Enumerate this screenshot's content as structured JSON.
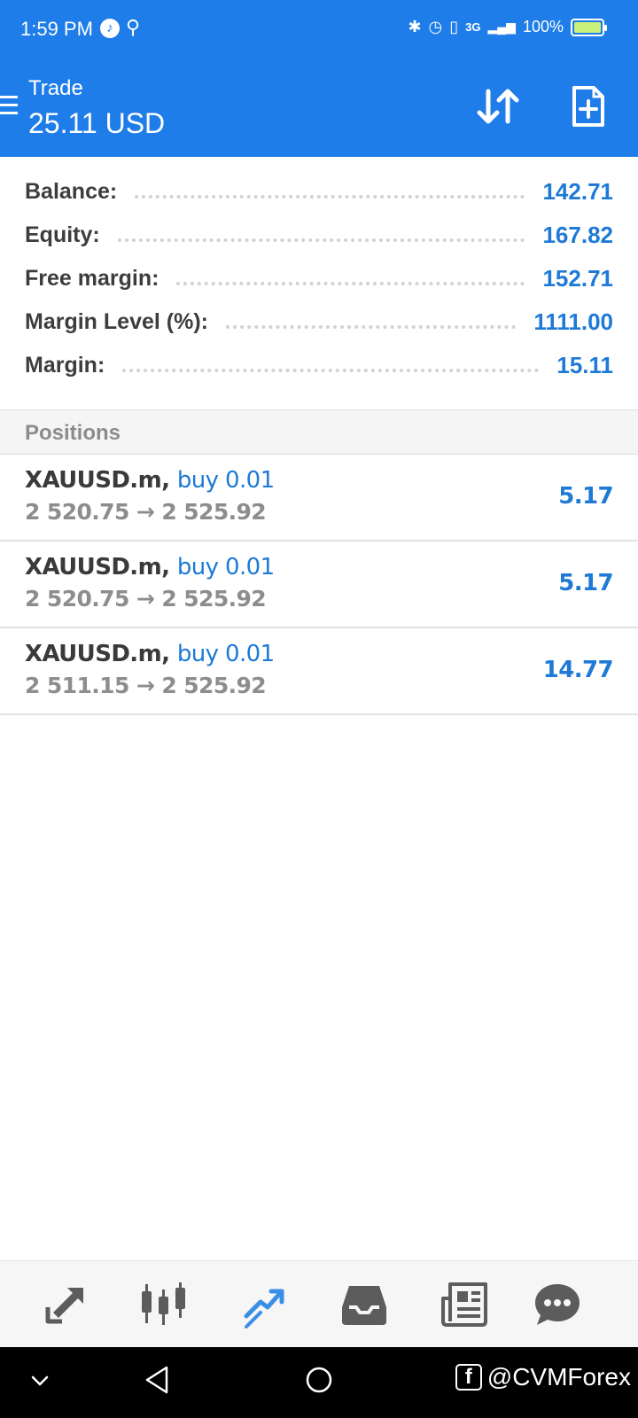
{
  "status_bar": {
    "time": "1:59 PM",
    "network": "3G",
    "battery_percent": "100%",
    "battery_level": 1.0
  },
  "header": {
    "title": "Trade",
    "subtitle": "25.11 USD"
  },
  "account": [
    {
      "label": "Balance:",
      "value": "142.71"
    },
    {
      "label": "Equity:",
      "value": "167.82"
    },
    {
      "label": "Free margin:",
      "value": "152.71"
    },
    {
      "label": "Margin Level (%):",
      "value": "1111.00"
    },
    {
      "label": "Margin:",
      "value": "15.11"
    }
  ],
  "positions_header": "Positions",
  "positions": [
    {
      "symbol": "XAUUSD.m,",
      "type": "buy 0.01",
      "prices": "2 520.75 → 2 525.92",
      "profit": "5.17"
    },
    {
      "symbol": "XAUUSD.m,",
      "type": "buy 0.01",
      "prices": "2 520.75 → 2 525.92",
      "profit": "5.17"
    },
    {
      "symbol": "XAUUSD.m,",
      "type": "buy 0.01",
      "prices": "2 511.15 → 2 525.92",
      "profit": "14.77"
    }
  ],
  "tabs": [
    {
      "icon": "quotes-icon",
      "active": false
    },
    {
      "icon": "chart-icon",
      "active": false
    },
    {
      "icon": "trade-icon",
      "active": true
    },
    {
      "icon": "history-icon",
      "active": false
    },
    {
      "icon": "news-icon",
      "active": false
    },
    {
      "icon": "chat-icon",
      "active": false
    }
  ],
  "colors": {
    "primary": "#1e7de8",
    "value_blue": "#1e7ad6",
    "tab_inactive": "#5c5c5c",
    "tab_active": "#3a8ee6"
  },
  "watermark": "@CVMForex"
}
